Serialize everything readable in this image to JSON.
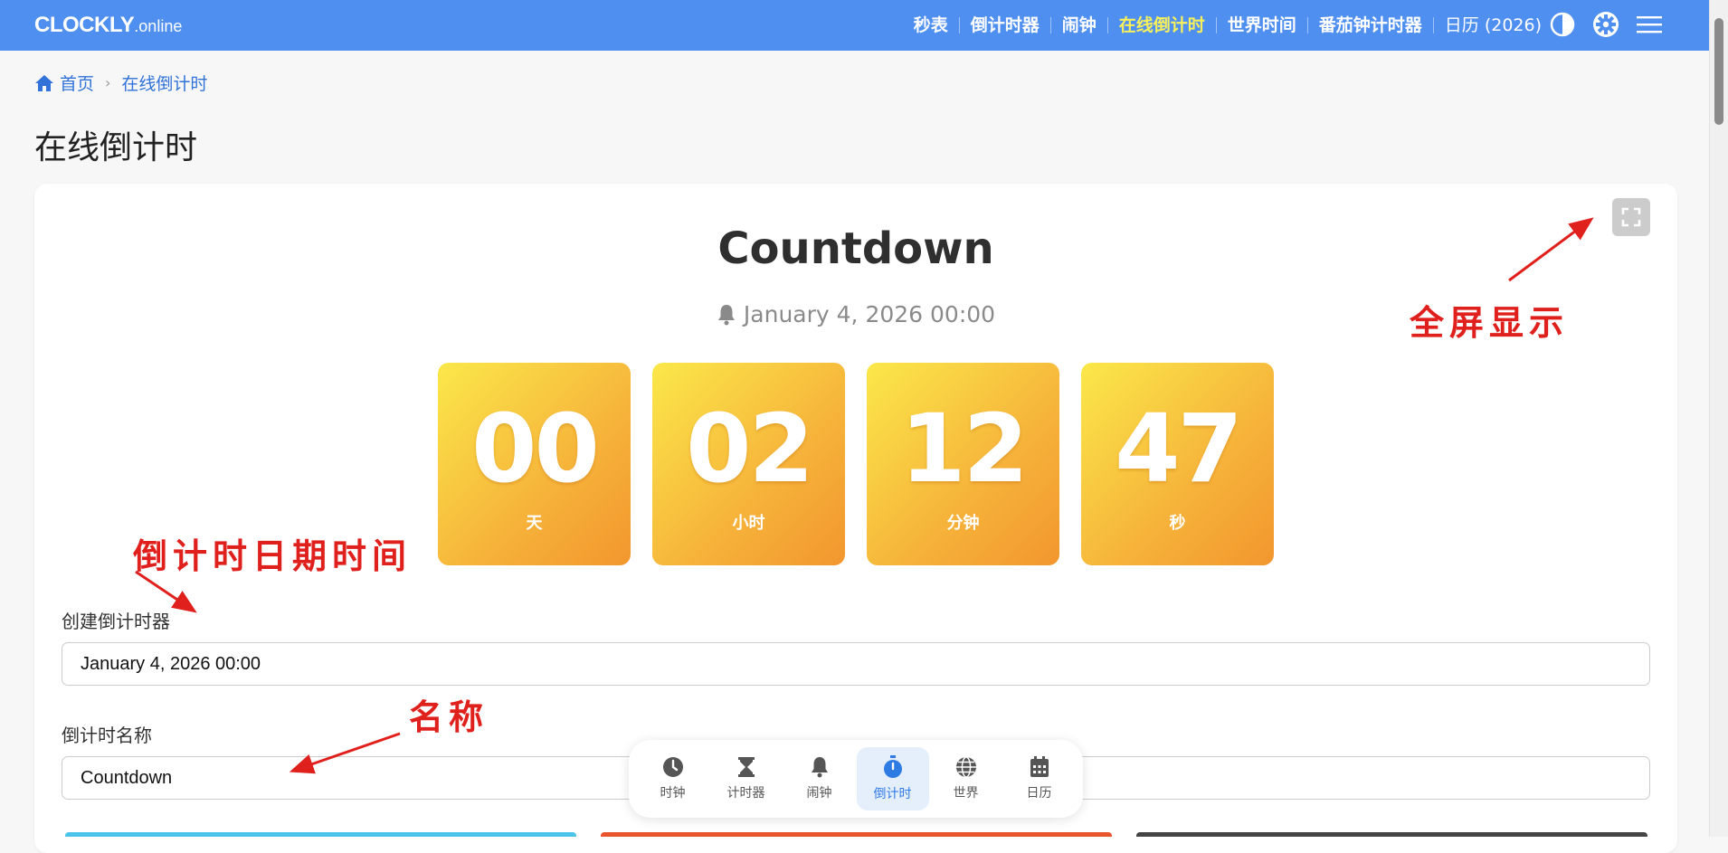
{
  "header": {
    "logo_main": "CLOCKLY",
    "logo_suffix": ".online",
    "nav": [
      {
        "label": "秒表"
      },
      {
        "label": "倒计时器"
      },
      {
        "label": "闹钟"
      },
      {
        "label": "在线倒计时",
        "active": true
      },
      {
        "label": "世界时间"
      },
      {
        "label": "番茄钟计时器"
      },
      {
        "label": "日历 (2026)"
      }
    ],
    "icons": [
      "contrast-icon",
      "gear-icon",
      "hamburger-menu-icon"
    ],
    "colors": {
      "bar": "#4f8ff0",
      "active": "#f7f05c"
    }
  },
  "breadcrumb": {
    "home": "首页",
    "current": "在线倒计时"
  },
  "page_title": "在线倒计时",
  "countdown": {
    "title": "Countdown",
    "target_date": "January 4, 2026 00:00",
    "units": [
      {
        "value": "00",
        "label": "天"
      },
      {
        "value": "02",
        "label": "小时"
      },
      {
        "value": "12",
        "label": "分钟"
      },
      {
        "value": "47",
        "label": "秒"
      }
    ]
  },
  "form": {
    "date_label": "创建倒计时器",
    "date_value": "January 4, 2026 00:00",
    "name_label": "倒计时名称",
    "name_value": "Countdown"
  },
  "bottom_nav": [
    {
      "label": "时钟",
      "icon": "clock-icon"
    },
    {
      "label": "计时器",
      "icon": "hourglass-icon"
    },
    {
      "label": "闹钟",
      "icon": "bell-icon"
    },
    {
      "label": "倒计时",
      "icon": "stopwatch-icon",
      "active": true
    },
    {
      "label": "世界",
      "icon": "globe-icon"
    },
    {
      "label": "日历",
      "icon": "calendar-icon"
    }
  ],
  "annotations": {
    "fullscreen": "全屏显示",
    "date": "倒计时日期时间",
    "name": "名称",
    "color": "#e0201c"
  }
}
